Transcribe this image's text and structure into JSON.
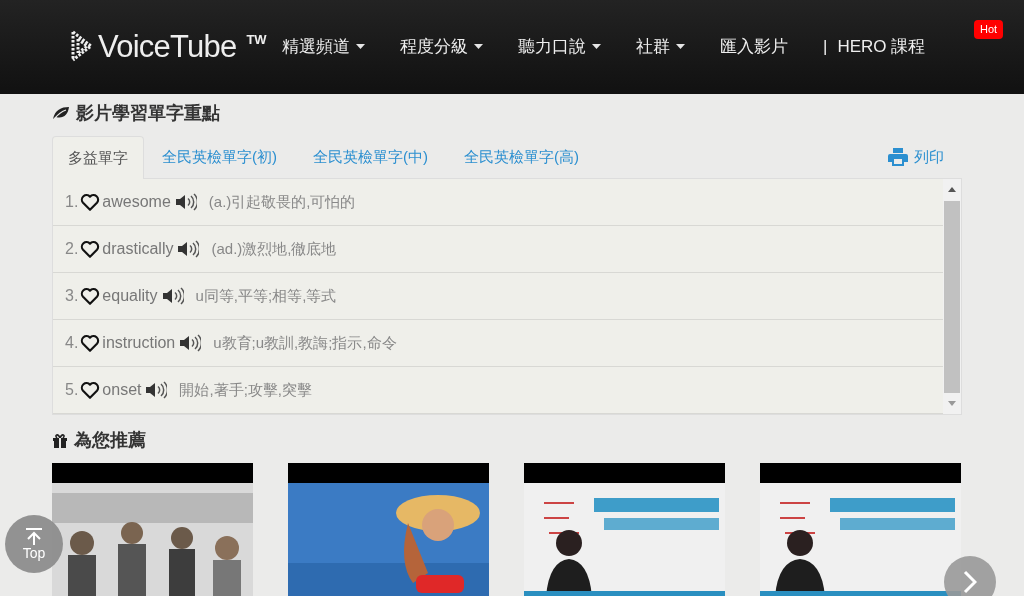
{
  "header": {
    "logo": "VoiceTube",
    "region": "TW",
    "nav": [
      {
        "label": "精選頻道",
        "dropdown": true
      },
      {
        "label": "程度分級",
        "dropdown": true
      },
      {
        "label": "聽力口說",
        "dropdown": true
      },
      {
        "label": "社群",
        "dropdown": true
      },
      {
        "label": "匯入影片",
        "dropdown": false
      }
    ],
    "hero": {
      "separator": "|",
      "label": "HERO 課程",
      "badge": "Hot"
    }
  },
  "vocab": {
    "title": "影片學習單字重點",
    "tabs": [
      {
        "label": "多益單字",
        "selected": true
      },
      {
        "label": "全民英檢單字(初)",
        "selected": false
      },
      {
        "label": "全民英檢單字(中)",
        "selected": false
      },
      {
        "label": "全民英檢單字(高)",
        "selected": false
      }
    ],
    "print": "列印",
    "words": [
      {
        "number": "1.",
        "word": "awesome",
        "meaning": "(a.)引起敬畏的,可怕的"
      },
      {
        "number": "2.",
        "word": "drastically",
        "meaning": "(ad.)激烈地,徹底地"
      },
      {
        "number": "3.",
        "word": "equality",
        "meaning": "u同等,平等;相等,等式"
      },
      {
        "number": "4.",
        "word": "instruction",
        "meaning": "u教育;u教訓,教誨;指示,命令"
      },
      {
        "number": "5.",
        "word": "onset",
        "meaning": "開始,著手;攻擊,突擊"
      }
    ]
  },
  "recommend": {
    "title": "為您推薦"
  },
  "top_button": "Top"
}
